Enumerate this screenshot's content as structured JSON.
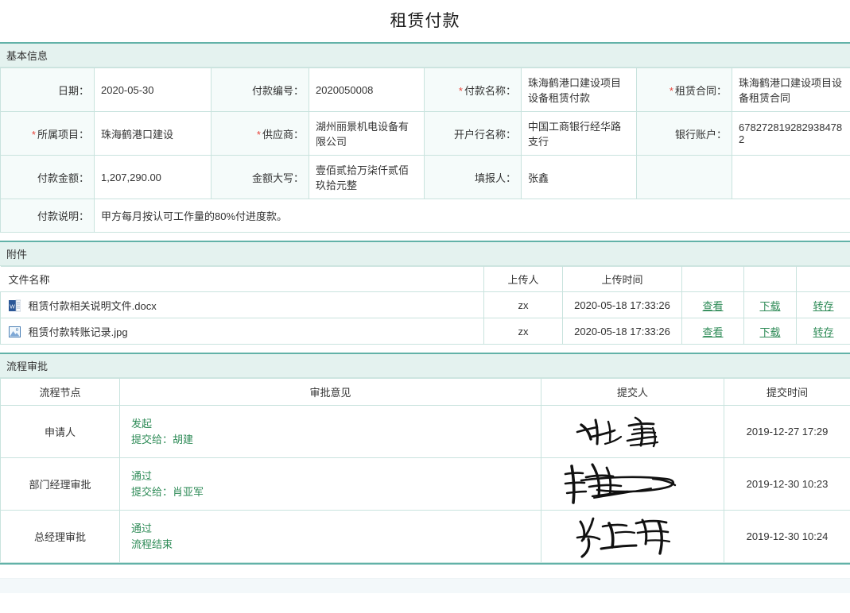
{
  "page": {
    "title": "租赁付款"
  },
  "basic_info": {
    "section_title": "基本信息",
    "rows": [
      [
        {
          "label": "日期：",
          "value": "2020-05-30",
          "required": false
        },
        {
          "label": "付款编号：",
          "value": "2020050008",
          "required": false
        },
        {
          "label": "付款名称：",
          "value": "珠海鹤港口建设项目设备租赁付款",
          "required": true
        },
        {
          "label": "租赁合同：",
          "value": "珠海鹤港口建设项目设备租赁合同",
          "required": true
        }
      ],
      [
        {
          "label": "所属项目：",
          "value": "珠海鹤港口建设",
          "required": true
        },
        {
          "label": "供应商：",
          "value": "湖州丽景机电设备有限公司",
          "required": true
        },
        {
          "label": "开户行名称：",
          "value": "中国工商银行经华路支行",
          "required": false
        },
        {
          "label": "银行账户：",
          "value": "6782728192829384782",
          "required": false
        }
      ],
      [
        {
          "label": "付款金额：",
          "value": "1,207,290.00",
          "required": false
        },
        {
          "label": "金额大写：",
          "value": "壹佰贰拾万柒仟贰佰玖拾元整",
          "required": false
        },
        {
          "label": "填报人：",
          "value": "张鑫",
          "required": false
        },
        {
          "label": "",
          "value": "",
          "required": false
        }
      ]
    ],
    "note_label": "付款说明：",
    "note_value": "甲方每月按认可工作量的80%付进度款。"
  },
  "attachments": {
    "section_title": "附件",
    "columns": [
      "文件名称",
      "上传人",
      "上传时间",
      "",
      "",
      ""
    ],
    "actions": {
      "view": "查看",
      "download": "下载",
      "save": "转存"
    },
    "rows": [
      {
        "icon": "word-file-icon",
        "name": "租赁付款相关说明文件.docx",
        "uploader": "zx",
        "uploaded_at": "2020-05-18 17:33:26"
      },
      {
        "icon": "image-file-icon",
        "name": "租赁付款转账记录.jpg",
        "uploader": "zx",
        "uploaded_at": "2020-05-18 17:33:26"
      }
    ]
  },
  "flow": {
    "section_title": "流程审批",
    "columns": [
      "流程节点",
      "审批意见",
      "提交人",
      "提交时间"
    ],
    "rows": [
      {
        "node": "申请人",
        "opinion_line1": "发起",
        "opinion_line2": "提交给：胡建",
        "signature_name": "张鑫",
        "time": "2019-12-27 17:29"
      },
      {
        "node": "部门经理审批",
        "opinion_line1": "通过",
        "opinion_line2": "提交给：肖亚军",
        "signature_name": "胡建",
        "time": "2019-12-30 10:23"
      },
      {
        "node": "总经理审批",
        "opinion_line1": "通过",
        "opinion_line2": "流程结束",
        "signature_name": "肖亚军",
        "time": "2019-12-30 10:24"
      }
    ]
  },
  "colors": {
    "accent": "#62b2a8",
    "section_bg": "#e4f2ef",
    "label_bg": "#f5fbfa",
    "border": "#c9e3de",
    "link": "#2e8b57",
    "required": "#e8443b"
  }
}
